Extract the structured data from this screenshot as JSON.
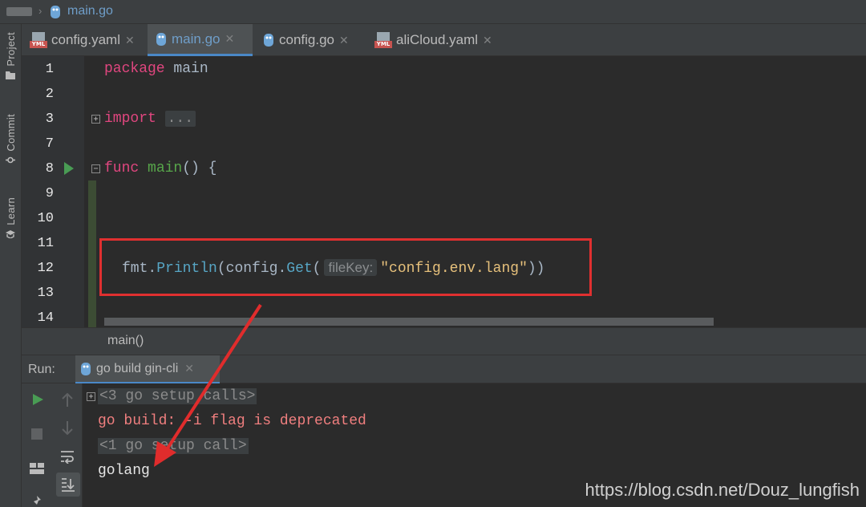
{
  "breadcrumb": {
    "file": "main.go"
  },
  "tool_stripe": [
    "Project",
    "Commit",
    "Learn"
  ],
  "tabs": [
    {
      "label": "config.yaml",
      "icon": "yaml-file-icon",
      "closable": true,
      "active": false
    },
    {
      "label": "main.go",
      "icon": "go-file-icon",
      "closable": true,
      "active": true
    },
    {
      "label": "config.go",
      "icon": "go-file-icon",
      "closable": true,
      "active": false
    },
    {
      "label": "aliCloud.yaml",
      "icon": "yaml-file-icon",
      "closable": true,
      "active": false
    }
  ],
  "editor": {
    "line_numbers": [
      "1",
      "2",
      "3",
      "7",
      "8",
      "9",
      "10",
      "11",
      "12",
      "13",
      "14"
    ],
    "line1": {
      "kw": "package",
      "rest": " main"
    },
    "line3": {
      "kw": "import",
      "collapsed": "..."
    },
    "line8": {
      "kw": "func",
      "name": " main",
      "rest": "() {"
    },
    "line12": {
      "pkg": "fmt.",
      "fn": "Println",
      "mid": "(config.",
      "fn2": "Get",
      "paren": "(",
      "hint": "fileKey:",
      "str": "\"config.env.lang\"",
      "close": "))"
    },
    "function_crumb": "main()"
  },
  "run_panel": {
    "label": "Run:",
    "tab": "go build gin-cli",
    "lines": {
      "setup_calls": "<3 go setup calls>",
      "deprecated": "go build: -i flag is deprecated",
      "setup_call": "<1 go setup call>",
      "output": "golang"
    }
  },
  "watermark": "https://blog.csdn.net/Douz_lungfish",
  "colors": {
    "keyword": "#e0467f",
    "function": "#57a64a",
    "string": "#e6c07b",
    "error_text": "#f07f7f",
    "highlight_box": "#e03030",
    "run_green": "#499c54"
  }
}
